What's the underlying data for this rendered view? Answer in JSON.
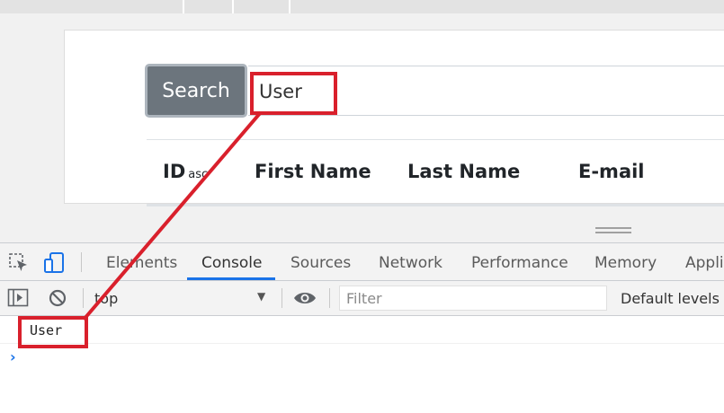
{
  "search": {
    "button_label": "Search",
    "input_value": "User"
  },
  "table": {
    "headers": [
      {
        "label": "ID",
        "sort": "asc"
      },
      {
        "label": "First Name"
      },
      {
        "label": "Last Name"
      },
      {
        "label": "E-mail"
      }
    ]
  },
  "devtools": {
    "tabs": [
      "Elements",
      "Console",
      "Sources",
      "Network",
      "Performance",
      "Memory",
      "Appli"
    ],
    "active_tab": "Console",
    "context": "top",
    "filter_placeholder": "Filter",
    "levels": "Default levels",
    "log_output": "User",
    "prompt": "›"
  },
  "annotation": {
    "color": "#d9202c"
  }
}
